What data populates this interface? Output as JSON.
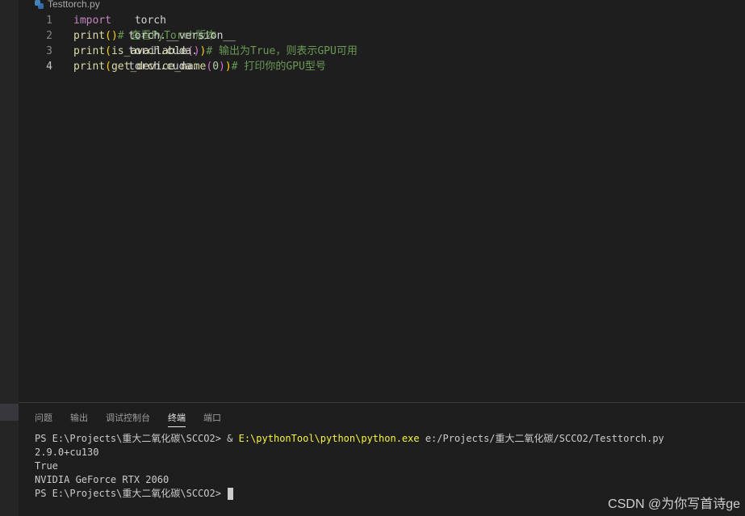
{
  "editor": {
    "tab_filename": "Testtorch.py",
    "lines": [
      {
        "n": "1",
        "parts": [
          [
            "kw",
            "import"
          ],
          [
            "txt",
            " torch"
          ]
        ]
      },
      {
        "n": "2",
        "parts": [
          [
            "fn",
            "print"
          ],
          [
            "br1",
            "("
          ],
          [
            "txt",
            "torch.__version__"
          ],
          [
            "br1",
            ")"
          ],
          [
            "txt",
            "  "
          ],
          [
            "cm",
            "# 查看PyTorch版本"
          ]
        ]
      },
      {
        "n": "3",
        "parts": [
          [
            "fn",
            "print"
          ],
          [
            "br1",
            "("
          ],
          [
            "txt",
            "torch.cuda."
          ],
          [
            "fn",
            "is_available"
          ],
          [
            "br2",
            "()"
          ],
          [
            "br1",
            ")"
          ],
          [
            "txt",
            "  "
          ],
          [
            "cm",
            "# 输出为True，则表示GPU可用"
          ]
        ]
      },
      {
        "n": "4",
        "parts": [
          [
            "fn",
            "print"
          ],
          [
            "br1",
            "("
          ],
          [
            "txt",
            "torch.cuda."
          ],
          [
            "fn",
            "get_device_name"
          ],
          [
            "br2",
            "("
          ],
          [
            "num",
            "0"
          ],
          [
            "br2",
            ")"
          ],
          [
            "br1",
            ")"
          ],
          [
            "txt",
            "  "
          ],
          [
            "cm",
            "# 打印你的GPU型号"
          ]
        ]
      }
    ]
  },
  "panel": {
    "tabs": [
      "问题",
      "输出",
      "调试控制台",
      "终端",
      "端口"
    ],
    "active_tab": "终端"
  },
  "terminal": {
    "line1_prompt": "PS E:\\Projects\\重大二氧化碳\\SCCO2> & ",
    "line1_exe": "E:\\pythonTool\\python\\python.exe",
    "line1_arg": " e:/Projects/重大二氧化碳/SCCO2/Testtorch.py",
    "line2": "2.9.0+cu130",
    "line3": "True",
    "line4": "NVIDIA GeForce RTX 2060",
    "line5_prompt": "PS E:\\Projects\\重大二氧化碳\\SCCO2> "
  },
  "watermark": "CSDN @为你写首诗ge"
}
